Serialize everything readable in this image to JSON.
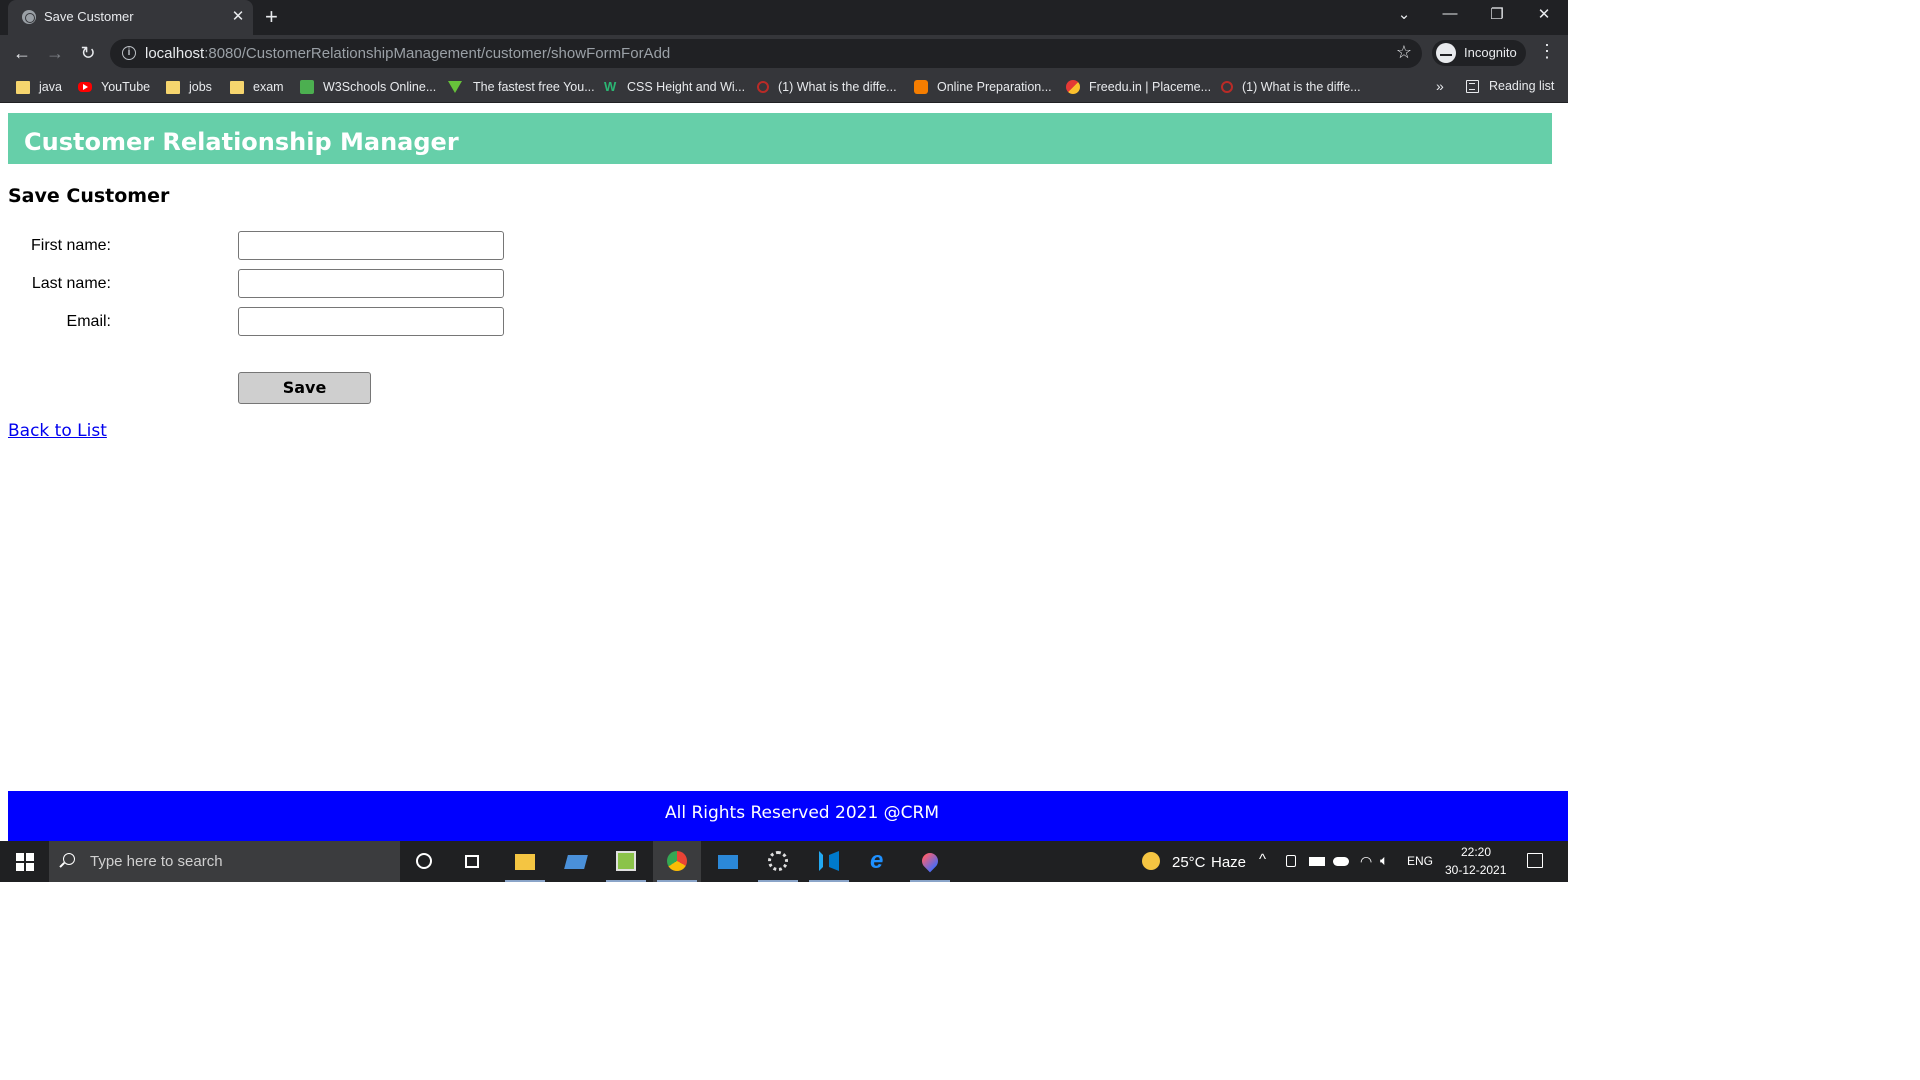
{
  "browser": {
    "tab_title": "Save Customer",
    "url_host": "localhost",
    "url_rest": ":8080/CustomerRelationshipManagement/customer/showFormForAdd",
    "profile_label": "Incognito",
    "bookmarks": [
      {
        "label": "java",
        "icon": "folder-icon"
      },
      {
        "label": "YouTube",
        "icon": "youtube-icon"
      },
      {
        "label": "jobs",
        "icon": "folder-icon"
      },
      {
        "label": "exam",
        "icon": "folder-icon"
      },
      {
        "label": "W3Schools Online...",
        "icon": "w3schools-icon"
      },
      {
        "label": "The fastest free You...",
        "icon": "download-arrow-icon"
      },
      {
        "label": "CSS Height and Wi...",
        "icon": "wix-icon"
      },
      {
        "label": "(1) What is the diffe...",
        "icon": "quora-icon"
      },
      {
        "label": "Online Preparation...",
        "icon": "blogger-icon"
      },
      {
        "label": "Freedu.in | Placeme...",
        "icon": "freedu-icon"
      },
      {
        "label": "(1) What is the diffe...",
        "icon": "quora-icon"
      }
    ],
    "more_bookmarks": "»",
    "reading_list_label": "Reading list"
  },
  "page": {
    "header_title": "Customer Relationship Manager",
    "form_title": "Save Customer",
    "fields": [
      {
        "label": "First name:",
        "value": ""
      },
      {
        "label": "Last name:",
        "value": ""
      },
      {
        "label": "Email:",
        "value": ""
      }
    ],
    "save_label": "Save",
    "back_link_label": "Back to List",
    "footer_text": "All Rights Reserved 2021 @CRM"
  },
  "taskbar": {
    "search_placeholder": "Type here to search",
    "weather_temp": "25°C",
    "weather_desc": "Haze",
    "language": "ENG",
    "time": "22:20",
    "date": "30-12-2021"
  },
  "colors": {
    "header_bg": "#66cfa9",
    "footer_bg": "#0000ff",
    "link": "#0000ee"
  }
}
